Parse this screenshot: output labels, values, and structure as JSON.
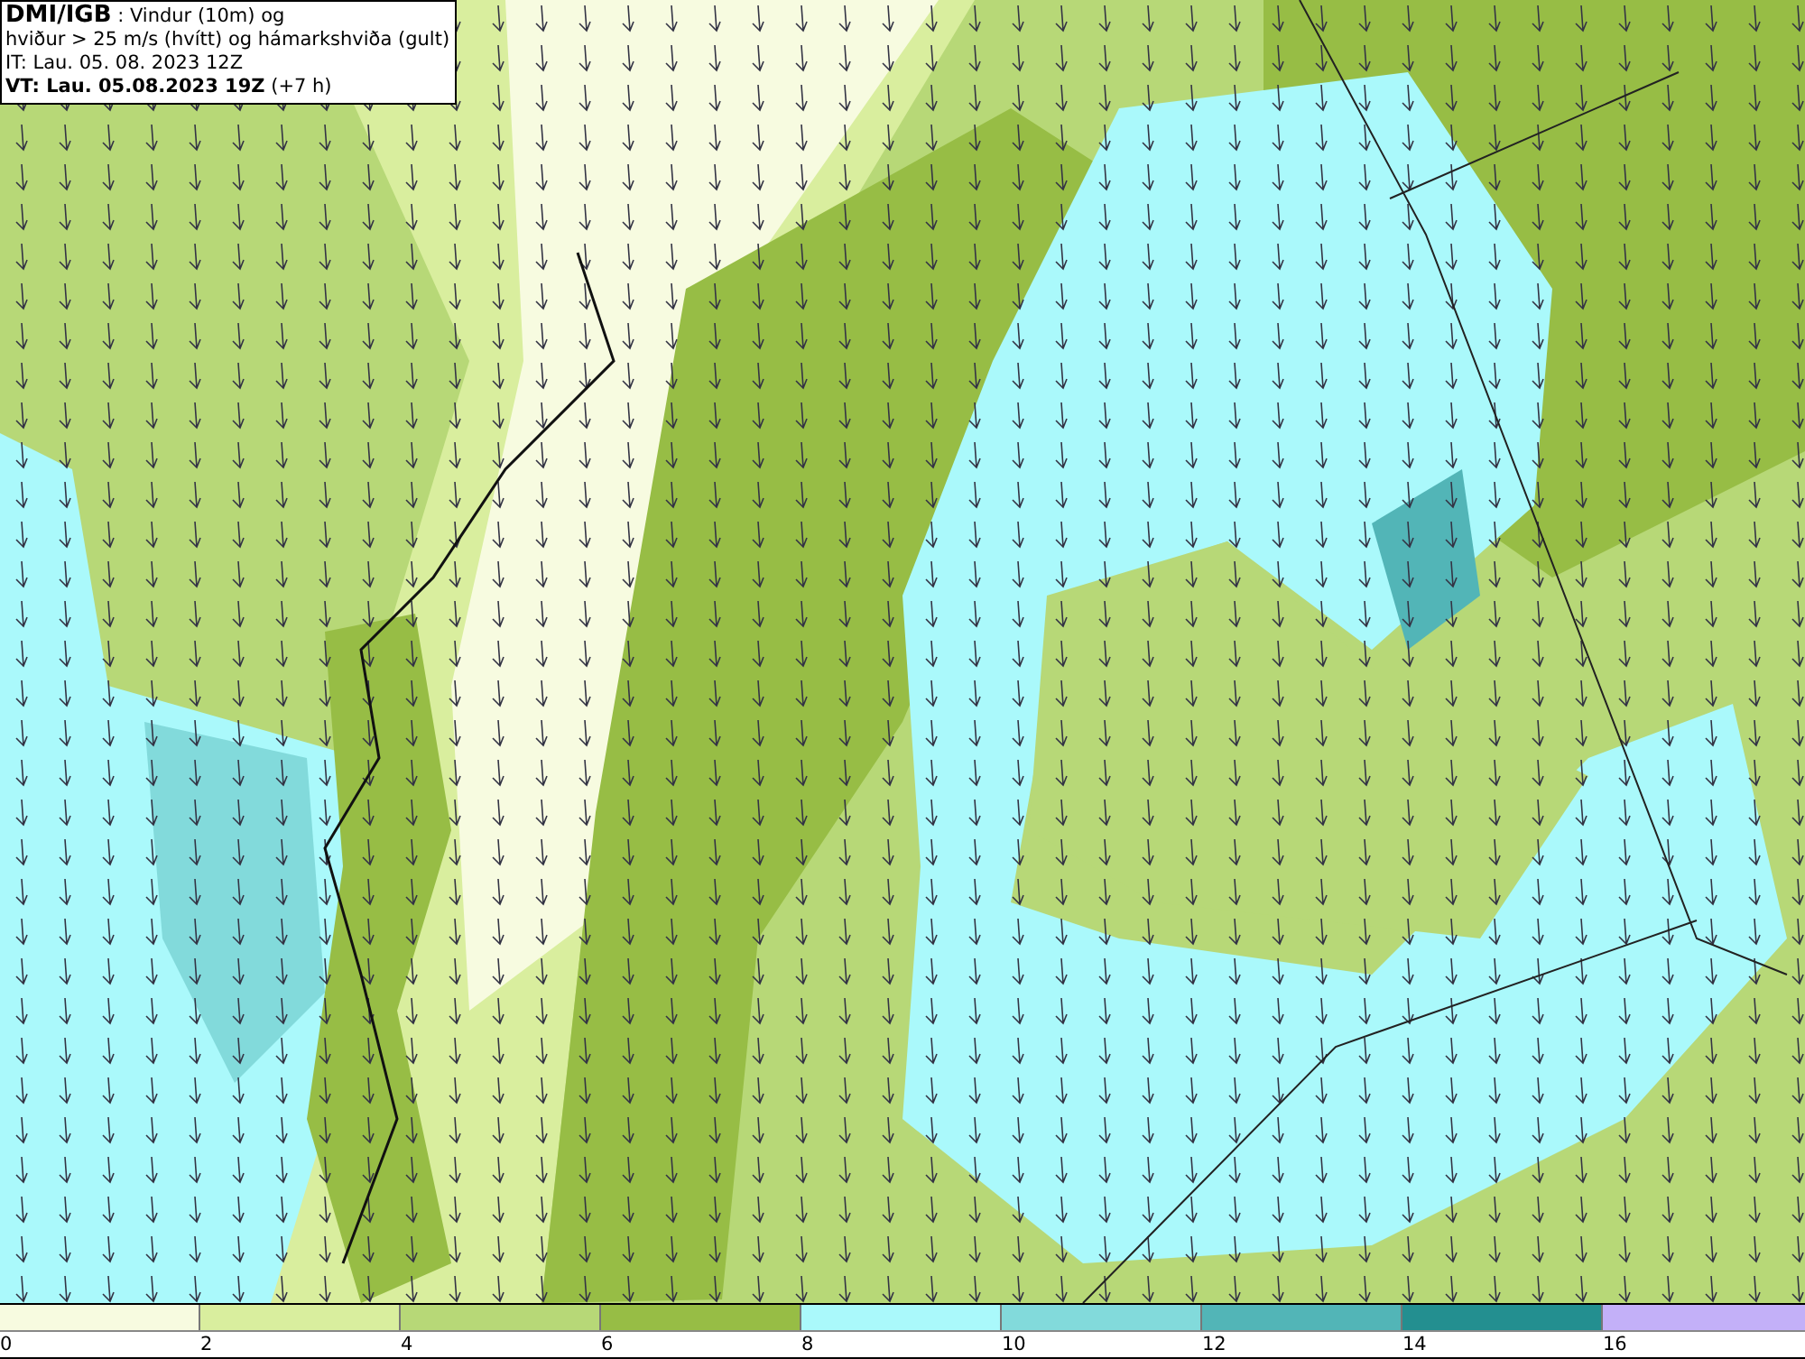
{
  "title_box": {
    "lines": [
      "**DMI/IGB** : Vindur (10m) og",
      "hviður > 25 m/s (hvítt) og hámarkshviða (gult)",
      "IT: Lau. 05. 08. 2023 12Z",
      "**VT: Lau. 05.08.2023 19Z** (+7 h)"
    ]
  },
  "legend": {
    "bins": [
      {
        "color": "#f7fbe0"
      },
      {
        "color": "#d9ee9e"
      },
      {
        "color": "#b7d877"
      },
      {
        "color": "#97bd45"
      },
      {
        "color": "#aaf9fb"
      },
      {
        "color": "#82dadb"
      },
      {
        "color": "#52b5b7"
      },
      {
        "color": "#238f90"
      },
      {
        "color": "#c3b0f8"
      }
    ],
    "ticks": [
      "0",
      "2",
      "4",
      "6",
      "8",
      "10",
      "12",
      "14",
      "16"
    ]
  }
}
